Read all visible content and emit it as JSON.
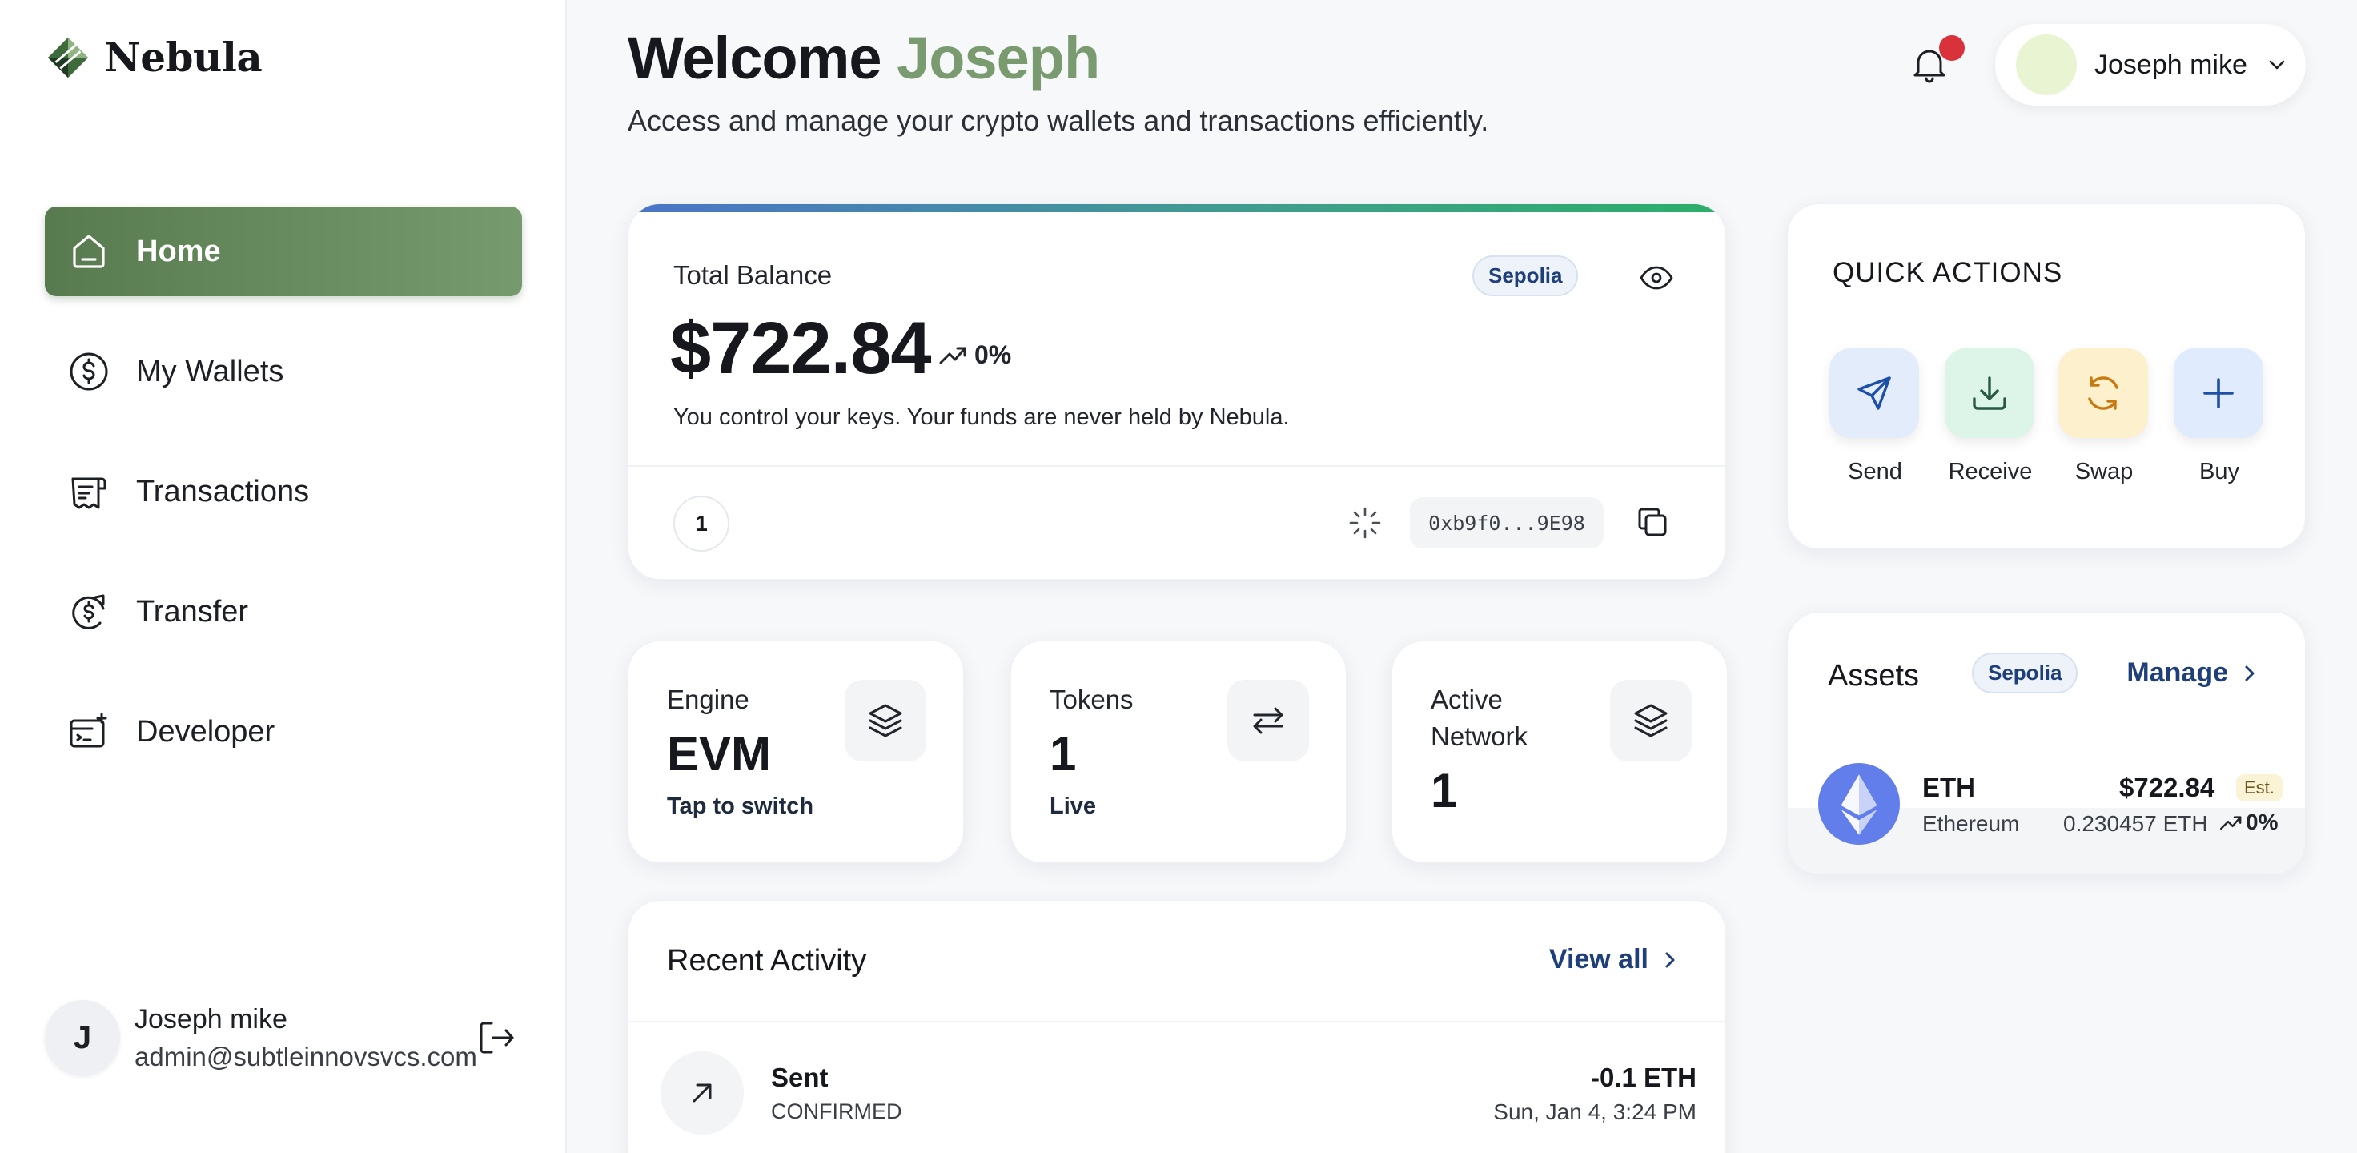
{
  "app": {
    "brand": "Nebula"
  },
  "sidebar": {
    "items": [
      {
        "label": "Home",
        "icon": "home-icon",
        "active": true
      },
      {
        "label": "My Wallets",
        "icon": "dollar-circle-icon"
      },
      {
        "label": "Transactions",
        "icon": "receipt-icon"
      },
      {
        "label": "Transfer",
        "icon": "transfer-icon"
      },
      {
        "label": "Developer",
        "icon": "developer-icon"
      }
    ],
    "user": {
      "initial": "J",
      "name": "Joseph mike",
      "email": "admin@subtleinnovsvcs.com"
    }
  },
  "header": {
    "welcome_prefix": "Welcome",
    "welcome_name": "Joseph",
    "subtitle": "Access and manage your crypto wallets and transactions efficiently.",
    "profile_name": "Joseph mike",
    "has_notification": true
  },
  "balance": {
    "label": "Total Balance",
    "network": "Sepolia",
    "amount": "$722.84",
    "change": "0%",
    "note": "You control your keys. Your funds are never held by Nebula.",
    "count": "1",
    "address": "0xb9f0...9E98"
  },
  "stats": [
    {
      "label": "Engine",
      "value": "EVM",
      "sub": "Tap to switch",
      "icon": "layers-icon"
    },
    {
      "label": "Tokens",
      "value": "1",
      "sub": "Live",
      "icon": "swap-arrows-icon"
    },
    {
      "label": "Active Network",
      "value": "1",
      "sub": "",
      "icon": "layers-icon"
    }
  ],
  "activity": {
    "title": "Recent Activity",
    "link": "View all",
    "rows": [
      {
        "type": "Sent",
        "status": "CONFIRMED",
        "amount": "-0.1 ETH",
        "date": "Sun, Jan 4, 3:24 PM"
      }
    ]
  },
  "quick_actions": {
    "title": "QUICK ACTIONS",
    "items": [
      {
        "label": "Send",
        "icon": "send-icon",
        "bg": "#e3ecfb",
        "fg": "#1e4fa8"
      },
      {
        "label": "Receive",
        "icon": "download-icon",
        "bg": "#dcf5e8",
        "fg": "#2a5a45"
      },
      {
        "label": "Swap",
        "icon": "refresh-icon",
        "bg": "#fdf0cc",
        "fg": "#c77a12"
      },
      {
        "label": "Buy",
        "icon": "plus-icon",
        "bg": "#e0ecfd",
        "fg": "#1e4fa8"
      }
    ]
  },
  "assets": {
    "title": "Assets",
    "network": "Sepolia",
    "link": "Manage",
    "rows": [
      {
        "symbol": "ETH",
        "name": "Ethereum",
        "usd": "$722.84",
        "est": "Est.",
        "balance": "0.230457 ETH",
        "change": "0%"
      }
    ]
  },
  "colors": {
    "accent": "#6b8f62",
    "link": "#1e3f7a",
    "notification": "#d9323a"
  }
}
